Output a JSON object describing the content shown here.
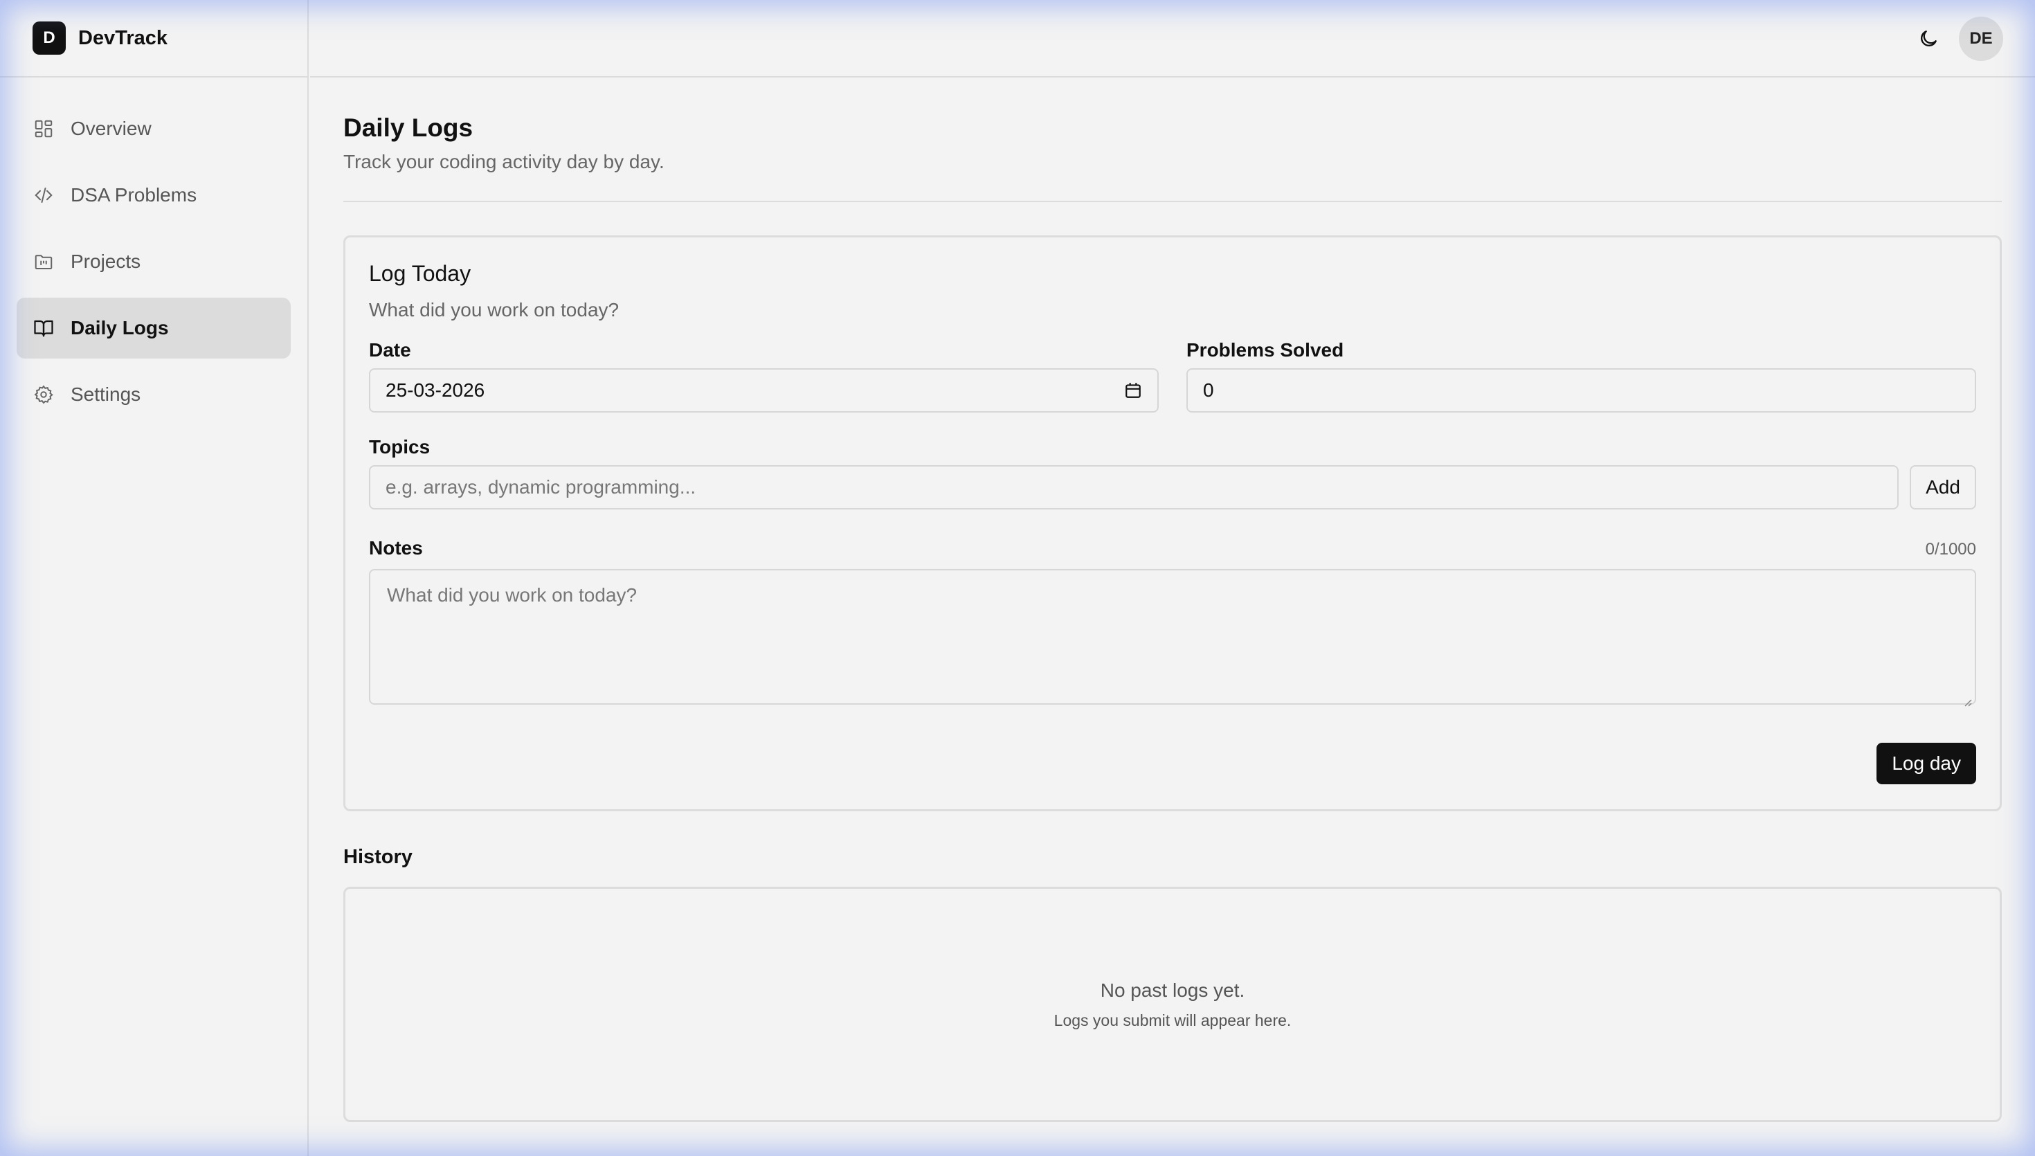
{
  "brand": {
    "logo_letter": "D",
    "name": "DevTrack"
  },
  "sidebar": {
    "items": [
      {
        "label": "Overview",
        "icon": "dashboard-icon"
      },
      {
        "label": "DSA Problems",
        "icon": "code-icon"
      },
      {
        "label": "Projects",
        "icon": "folder-kanban-icon"
      },
      {
        "label": "Daily Logs",
        "icon": "book-open-icon",
        "active": true
      },
      {
        "label": "Settings",
        "icon": "gear-icon"
      }
    ]
  },
  "topbar": {
    "theme_icon": "moon-icon",
    "avatar_initials": "DE"
  },
  "page": {
    "title": "Daily Logs",
    "subtitle": "Track your coding activity day by day."
  },
  "log_card": {
    "title": "Log Today",
    "subtitle": "What did you work on today?",
    "date_label": "Date",
    "date_value": "25-03-2026",
    "problems_label": "Problems Solved",
    "problems_value": "0",
    "topics_label": "Topics",
    "topics_placeholder": "e.g. arrays, dynamic programming...",
    "add_label": "Add",
    "notes_label": "Notes",
    "notes_counter": "0/1000",
    "notes_placeholder": "What did you work on today?",
    "submit_label": "Log day"
  },
  "history": {
    "title": "History",
    "empty_title": "No past logs yet.",
    "empty_subtitle": "Logs you submit will appear here."
  },
  "colors": {
    "accent": "#111111",
    "background": "#f3f3f3",
    "border": "#dcdcdc",
    "active_nav": "#dcdcdc"
  }
}
